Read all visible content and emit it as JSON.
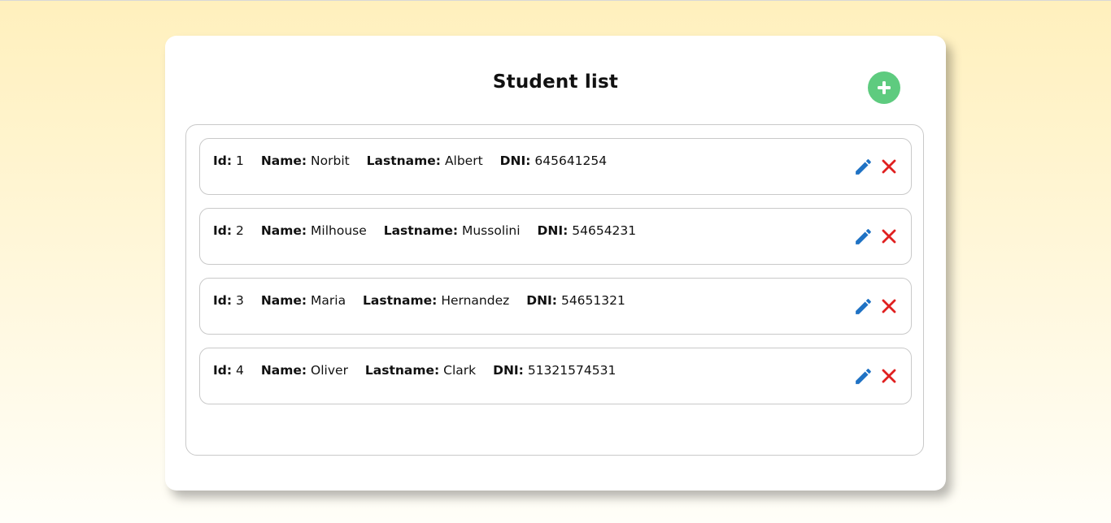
{
  "page": {
    "title": "Student list"
  },
  "labels": {
    "id": "Id:",
    "name": "Name:",
    "lastname": "Lastname:",
    "dni": "DNI:"
  },
  "students": [
    {
      "id": "1",
      "name": "Norbit",
      "lastname": "Albert",
      "dni": "645641254"
    },
    {
      "id": "2",
      "name": "Milhouse",
      "lastname": "Mussolini",
      "dni": "54654231"
    },
    {
      "id": "3",
      "name": "Maria",
      "lastname": "Hernandez",
      "dni": "54651321"
    },
    {
      "id": "4",
      "name": "Oliver",
      "lastname": "Clark",
      "dni": "51321574531"
    }
  ],
  "icons": {
    "add": "plus-icon",
    "edit": "pencil-icon",
    "delete": "close-icon"
  },
  "colors": {
    "add_button": "#5ecb7f",
    "edit_icon": "#1f72c4",
    "delete_icon": "#e02020"
  }
}
